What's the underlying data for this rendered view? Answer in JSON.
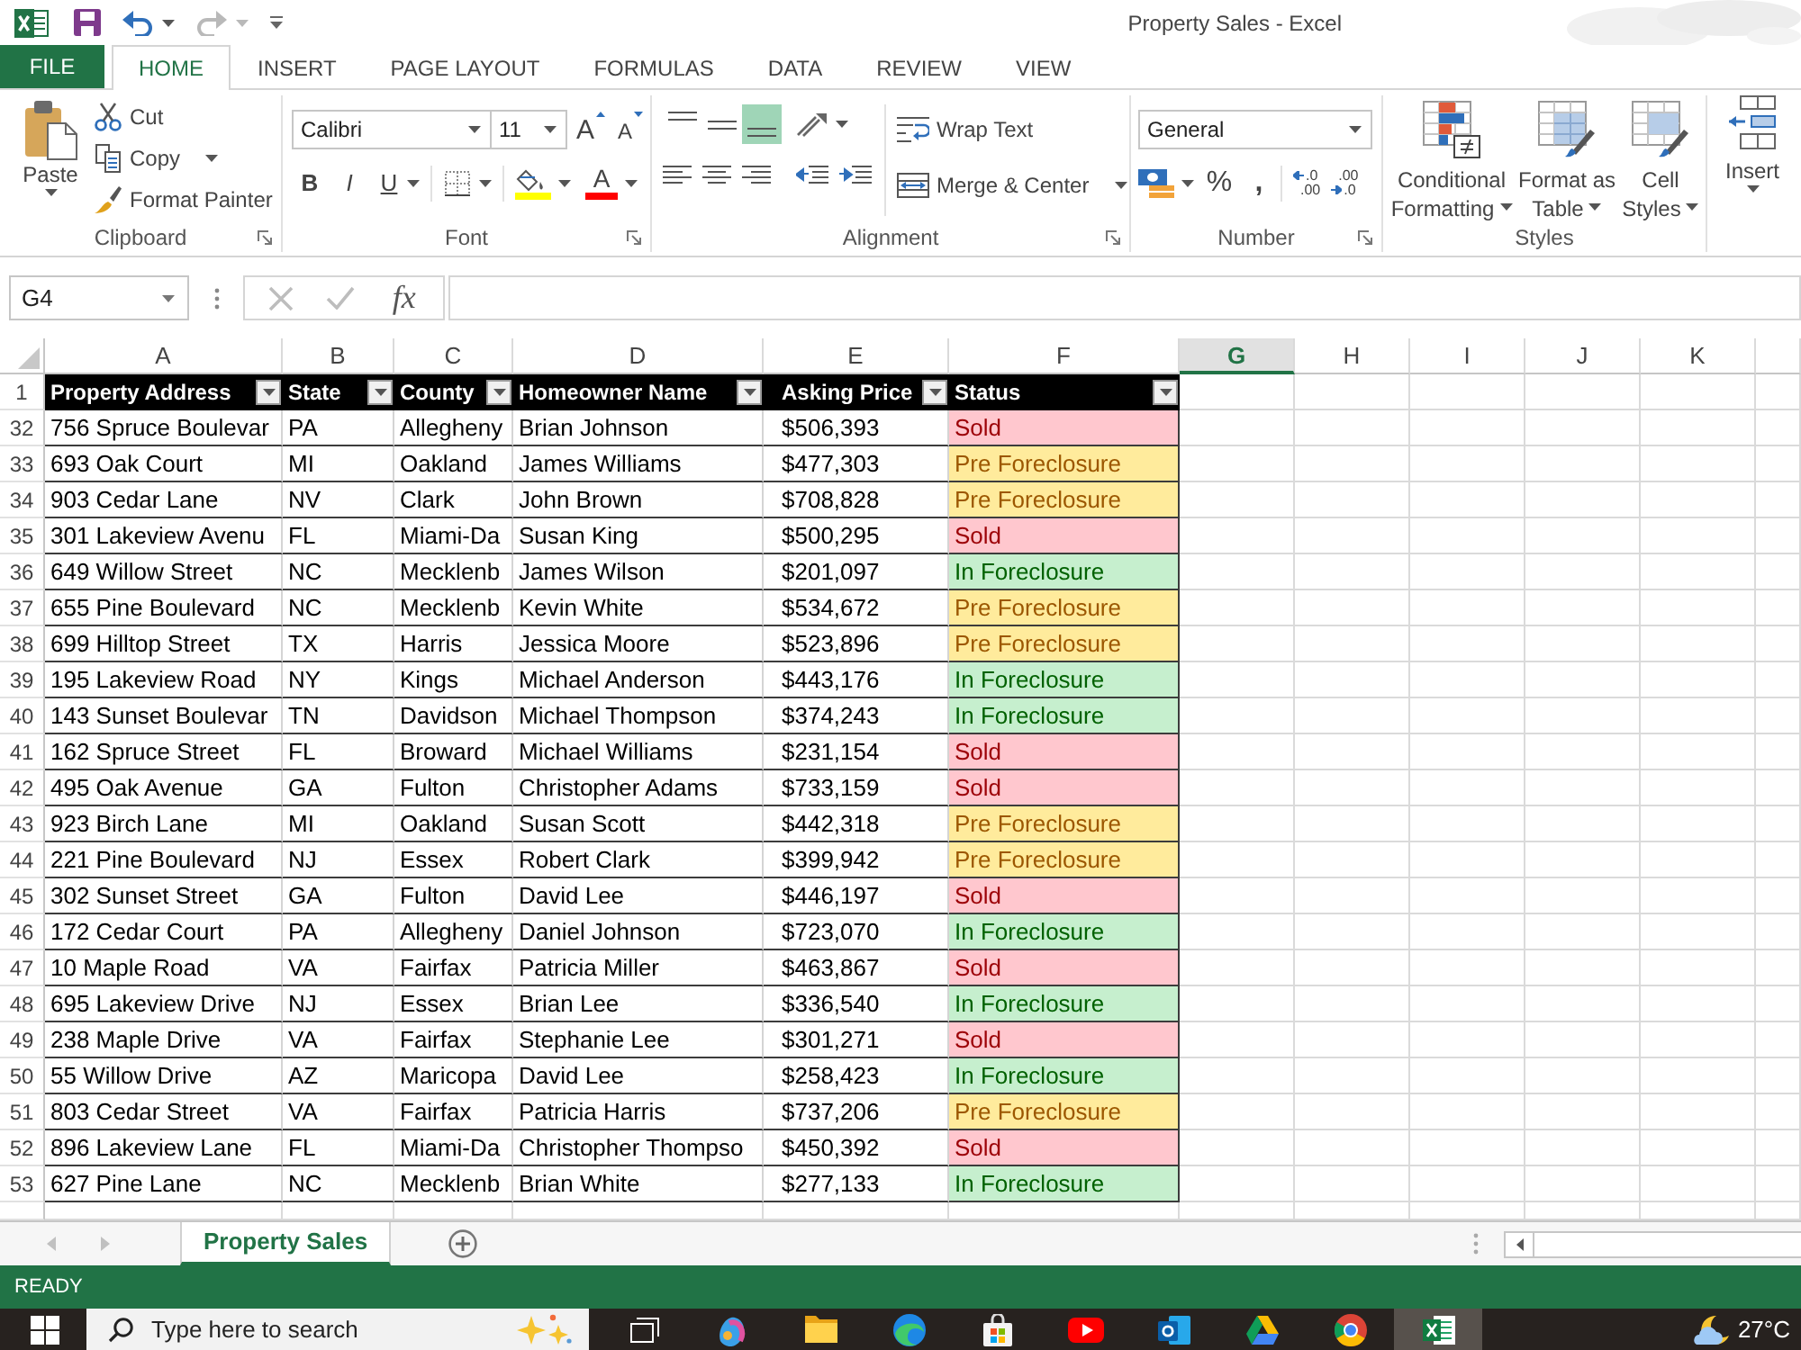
{
  "window": {
    "title": "Property Sales - Excel"
  },
  "quick_access": [
    {
      "kind": "save",
      "disabled": false
    },
    {
      "kind": "undo",
      "disabled": false
    },
    {
      "kind": "redo",
      "disabled": true
    }
  ],
  "tabs": [
    {
      "label": "FILE",
      "kind": "file",
      "selected": false
    },
    {
      "label": "HOME",
      "kind": "tab",
      "selected": true
    },
    {
      "label": "INSERT",
      "kind": "tab",
      "selected": false
    },
    {
      "label": "PAGE LAYOUT",
      "kind": "tab",
      "selected": false
    },
    {
      "label": "FORMULAS",
      "kind": "tab",
      "selected": false
    },
    {
      "label": "DATA",
      "kind": "tab",
      "selected": false
    },
    {
      "label": "REVIEW",
      "kind": "tab",
      "selected": false
    },
    {
      "label": "VIEW",
      "kind": "tab",
      "selected": false
    }
  ],
  "ribbon": {
    "clipboard": {
      "label": "Clipboard",
      "paste": "Paste",
      "cut": "Cut",
      "copy": "Copy",
      "format_painter": "Format Painter"
    },
    "font": {
      "label": "Font",
      "font_name": "Calibri",
      "font_size": "11",
      "grow_font": "A",
      "shrink_font": "A",
      "bold": "B",
      "italic": "I",
      "underline": "U",
      "font_color": "A"
    },
    "alignment": {
      "label": "Alignment",
      "vertical_align": [
        {
          "kind": "top",
          "selected": false
        },
        {
          "kind": "middle",
          "selected": false
        },
        {
          "kind": "bottom",
          "selected": true
        }
      ],
      "wrap_text": "Wrap Text",
      "merge_center": "Merge & Center"
    },
    "number": {
      "label": "Number",
      "format": "General",
      "percent": "%",
      "comma": ",",
      "increase_decimal": {
        "top": ".0",
        "bottom": ".00"
      },
      "decrease_decimal": {
        "top": ".00",
        "bottom": ".0"
      }
    },
    "styles": {
      "label": "Styles",
      "buttons": [
        {
          "kind": "conditional",
          "label": "Conditional Formatting"
        },
        {
          "kind": "table",
          "label": "Format as Table"
        },
        {
          "kind": "cell",
          "label": "Cell Styles"
        }
      ]
    },
    "cells": {
      "insert": "Insert"
    }
  },
  "formula_bar": {
    "name_box": "G4",
    "function_button": "fx"
  },
  "sheet": {
    "columns": [
      {
        "label": "A",
        "selected": false
      },
      {
        "label": "B",
        "selected": false
      },
      {
        "label": "C",
        "selected": false
      },
      {
        "label": "D",
        "selected": false
      },
      {
        "label": "E",
        "selected": false
      },
      {
        "label": "F",
        "selected": false
      },
      {
        "label": "G",
        "selected": true
      },
      {
        "label": "H",
        "selected": false
      },
      {
        "label": "I",
        "selected": false
      },
      {
        "label": "J",
        "selected": false
      },
      {
        "label": "K",
        "selected": false
      }
    ],
    "table": {
      "header_row_number": "1",
      "headers": [
        "Property Address",
        "State",
        "County",
        "Homeowner Name",
        "Asking Price",
        "Status"
      ],
      "rows": [
        {
          "number": "32",
          "cells": [
            "756 Spruce Boulevar",
            "PA",
            "Allegheny",
            "Brian Johnson",
            "$506,393"
          ],
          "status": {
            "text": "Sold",
            "kind": "sold"
          }
        },
        {
          "number": "33",
          "cells": [
            "693 Oak Court",
            "MI",
            "Oakland",
            "James Williams",
            "$477,303"
          ],
          "status": {
            "text": "Pre Foreclosure",
            "kind": "pre"
          }
        },
        {
          "number": "34",
          "cells": [
            "903 Cedar Lane",
            "NV",
            "Clark",
            "John Brown",
            "$708,828"
          ],
          "status": {
            "text": "Pre Foreclosure",
            "kind": "pre"
          }
        },
        {
          "number": "35",
          "cells": [
            "301 Lakeview Avenu",
            "FL",
            "Miami-Da",
            "Susan King",
            "$500,295"
          ],
          "status": {
            "text": "Sold",
            "kind": "sold"
          }
        },
        {
          "number": "36",
          "cells": [
            "649 Willow Street",
            "NC",
            "Mecklenb",
            "James Wilson",
            "$201,097"
          ],
          "status": {
            "text": "In Foreclosure",
            "kind": "in"
          }
        },
        {
          "number": "37",
          "cells": [
            "655 Pine Boulevard",
            "NC",
            "Mecklenb",
            "Kevin White",
            "$534,672"
          ],
          "status": {
            "text": "Pre Foreclosure",
            "kind": "pre"
          }
        },
        {
          "number": "38",
          "cells": [
            "699 Hilltop Street",
            "TX",
            "Harris",
            "Jessica Moore",
            "$523,896"
          ],
          "status": {
            "text": "Pre Foreclosure",
            "kind": "pre"
          }
        },
        {
          "number": "39",
          "cells": [
            "195 Lakeview Road",
            "NY",
            "Kings",
            "Michael Anderson",
            "$443,176"
          ],
          "status": {
            "text": "In Foreclosure",
            "kind": "in"
          }
        },
        {
          "number": "40",
          "cells": [
            "143 Sunset Boulevar",
            "TN",
            "Davidson",
            "Michael Thompson",
            "$374,243"
          ],
          "status": {
            "text": "In Foreclosure",
            "kind": "in"
          }
        },
        {
          "number": "41",
          "cells": [
            "162 Spruce Street",
            "FL",
            "Broward",
            "Michael Williams",
            "$231,154"
          ],
          "status": {
            "text": "Sold",
            "kind": "sold"
          }
        },
        {
          "number": "42",
          "cells": [
            "495 Oak Avenue",
            "GA",
            "Fulton",
            "Christopher Adams",
            "$733,159"
          ],
          "status": {
            "text": "Sold",
            "kind": "sold"
          }
        },
        {
          "number": "43",
          "cells": [
            "923 Birch Lane",
            "MI",
            "Oakland",
            "Susan Scott",
            "$442,318"
          ],
          "status": {
            "text": "Pre Foreclosure",
            "kind": "pre"
          }
        },
        {
          "number": "44",
          "cells": [
            "221 Pine Boulevard",
            "NJ",
            "Essex",
            "Robert Clark",
            "$399,942"
          ],
          "status": {
            "text": "Pre Foreclosure",
            "kind": "pre"
          }
        },
        {
          "number": "45",
          "cells": [
            "302 Sunset Street",
            "GA",
            "Fulton",
            "David Lee",
            "$446,197"
          ],
          "status": {
            "text": "Sold",
            "kind": "sold"
          }
        },
        {
          "number": "46",
          "cells": [
            "172 Cedar Court",
            "PA",
            "Allegheny",
            "Daniel Johnson",
            "$723,070"
          ],
          "status": {
            "text": "In Foreclosure",
            "kind": "in"
          }
        },
        {
          "number": "47",
          "cells": [
            "10 Maple Road",
            "VA",
            "Fairfax",
            "Patricia Miller",
            "$463,867"
          ],
          "status": {
            "text": "Sold",
            "kind": "sold"
          }
        },
        {
          "number": "48",
          "cells": [
            "695 Lakeview Drive",
            "NJ",
            "Essex",
            "Brian Lee",
            "$336,540"
          ],
          "status": {
            "text": "In Foreclosure",
            "kind": "in"
          }
        },
        {
          "number": "49",
          "cells": [
            "238 Maple Drive",
            "VA",
            "Fairfax",
            "Stephanie Lee",
            "$301,271"
          ],
          "status": {
            "text": "Sold",
            "kind": "sold"
          }
        },
        {
          "number": "50",
          "cells": [
            "55 Willow Drive",
            "AZ",
            "Maricopa",
            "David Lee",
            "$258,423"
          ],
          "status": {
            "text": "In Foreclosure",
            "kind": "in"
          }
        },
        {
          "number": "51",
          "cells": [
            "803 Cedar Street",
            "VA",
            "Fairfax",
            "Patricia Harris",
            "$737,206"
          ],
          "status": {
            "text": "Pre Foreclosure",
            "kind": "pre"
          }
        },
        {
          "number": "52",
          "cells": [
            "896 Lakeview Lane",
            "FL",
            "Miami-Da",
            "Christopher Thompso",
            "$450,392"
          ],
          "status": {
            "text": "Sold",
            "kind": "sold"
          }
        },
        {
          "number": "53",
          "cells": [
            "627 Pine Lane",
            "NC",
            "Mecklenb",
            "Brian White",
            "$277,133"
          ],
          "status": {
            "text": "In Foreclosure",
            "kind": "in"
          }
        }
      ]
    }
  },
  "sheet_tabs": [
    {
      "label": "Property Sales",
      "selected": true
    }
  ],
  "status_bar": {
    "text": "READY"
  },
  "taskbar": {
    "search": {
      "placeholder": "Type here to search"
    },
    "apps": [
      {
        "kind": "taskview",
        "active": false
      },
      {
        "kind": "swirl",
        "active": false
      },
      {
        "kind": "folder",
        "active": false
      },
      {
        "kind": "wave",
        "active": false
      },
      {
        "kind": "store",
        "active": false
      },
      {
        "kind": "video",
        "active": false
      },
      {
        "kind": "mail",
        "active": false
      },
      {
        "kind": "drive",
        "active": false
      },
      {
        "kind": "chrome",
        "active": false
      },
      {
        "kind": "excel",
        "active": true
      }
    ],
    "weather": {
      "temperature": "27°C"
    }
  }
}
